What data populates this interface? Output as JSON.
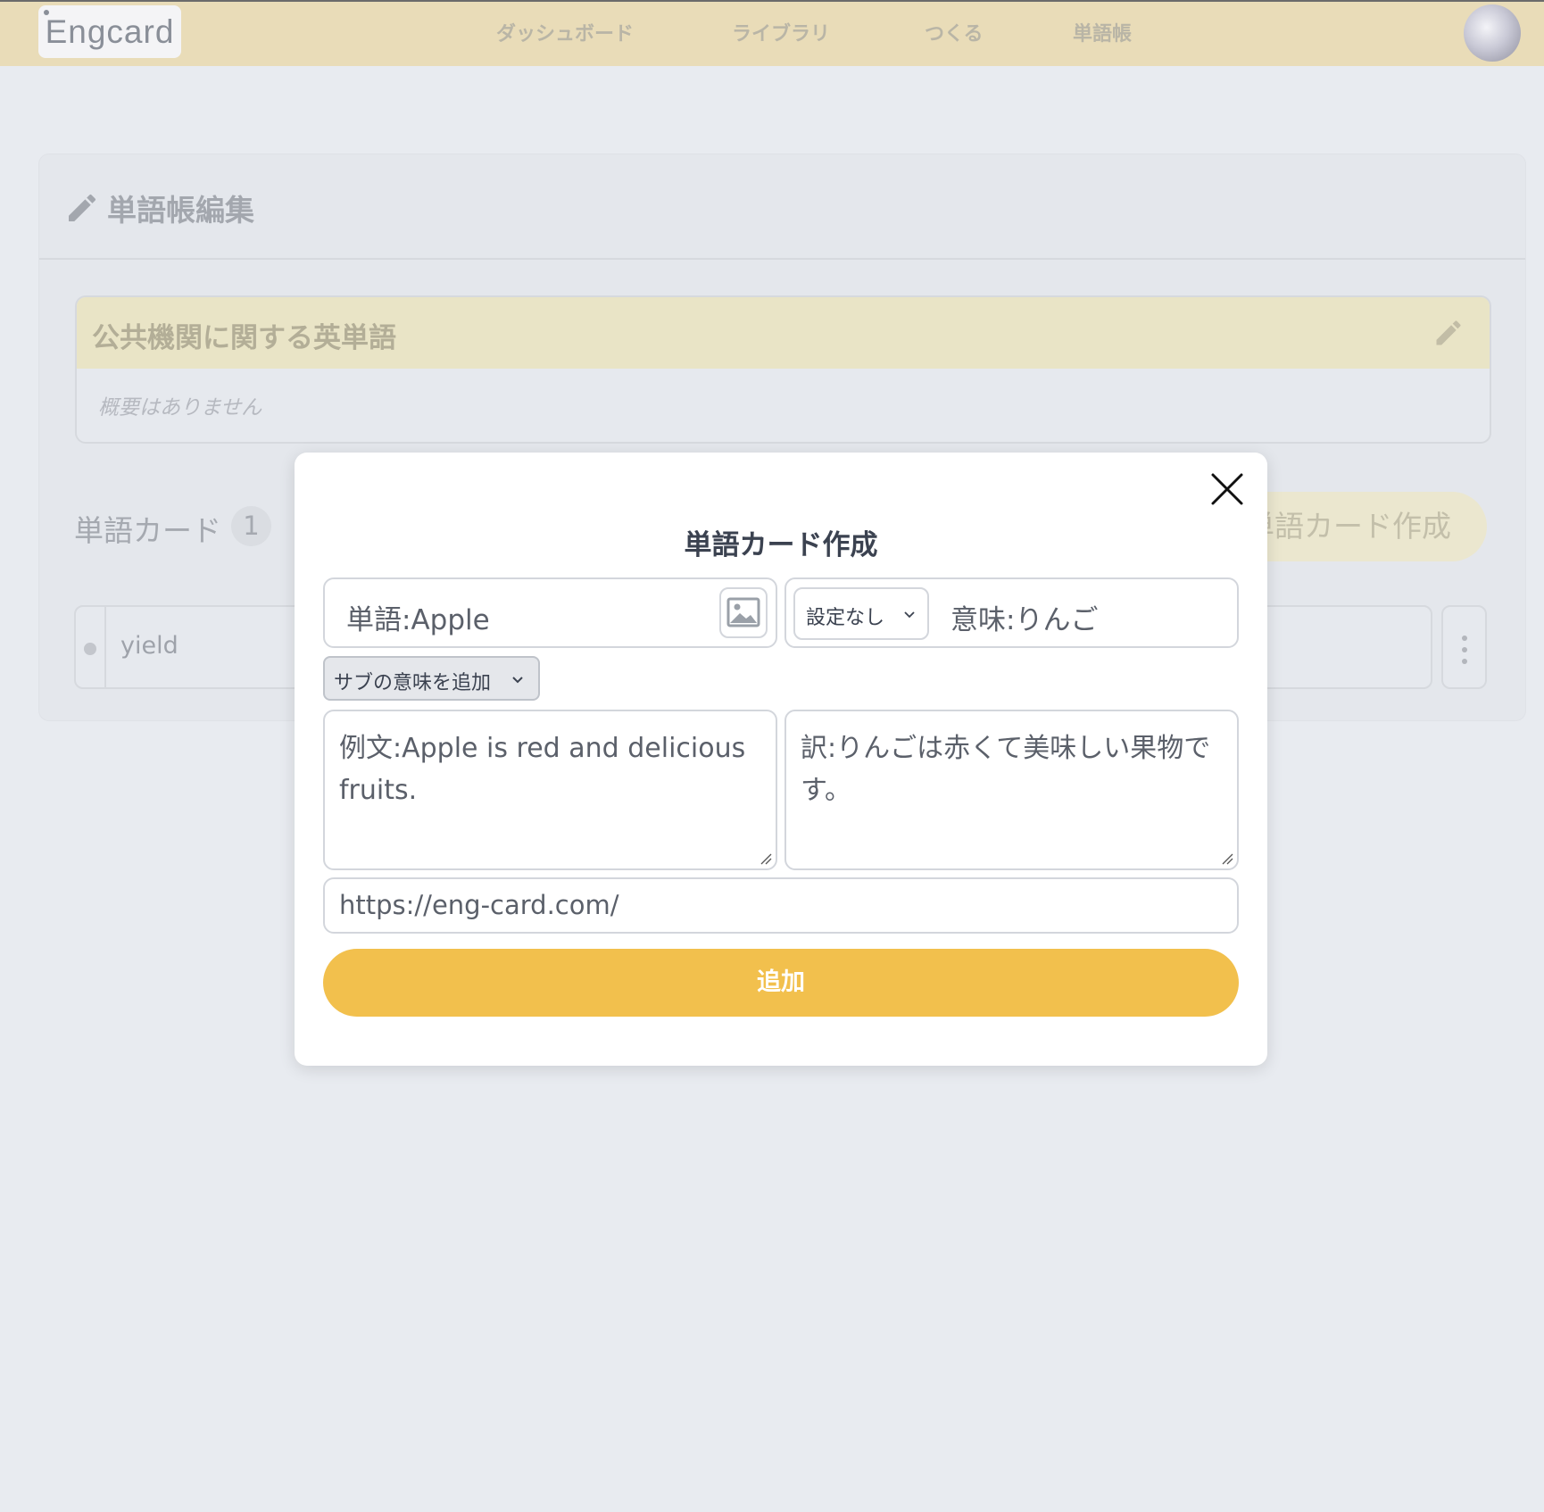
{
  "app": {
    "logo": "Engcard"
  },
  "nav": {
    "dashboard": "ダッシュボード",
    "library": "ライブラリ",
    "create": "つくる",
    "wordbook": "単語帳"
  },
  "page": {
    "title": "単語帳編集",
    "book_title": "公共機関に関する英単語",
    "book_description": "概要はありません",
    "cards_label": "単語カード",
    "cards_count": "1",
    "create_card_button": "単語カード作成",
    "cards": [
      {
        "word": "yield"
      }
    ]
  },
  "modal": {
    "title": "単語カード作成",
    "word_value": "単語:Apple",
    "part_of_speech": "設定なし",
    "meaning_value": "意味:りんご",
    "add_sub_meaning": "サブの意味を追加",
    "example_value": "例文:Apple is red and delicious fruits.",
    "translation_value": "訳:りんごは赤くて美味しい果物です。",
    "url_value": "https://eng-card.com/",
    "submit_label": "追加"
  },
  "colors": {
    "header_bg": "#e9dcb8",
    "accent": "#f2c04d",
    "page_bg": "#e8ebf0"
  }
}
